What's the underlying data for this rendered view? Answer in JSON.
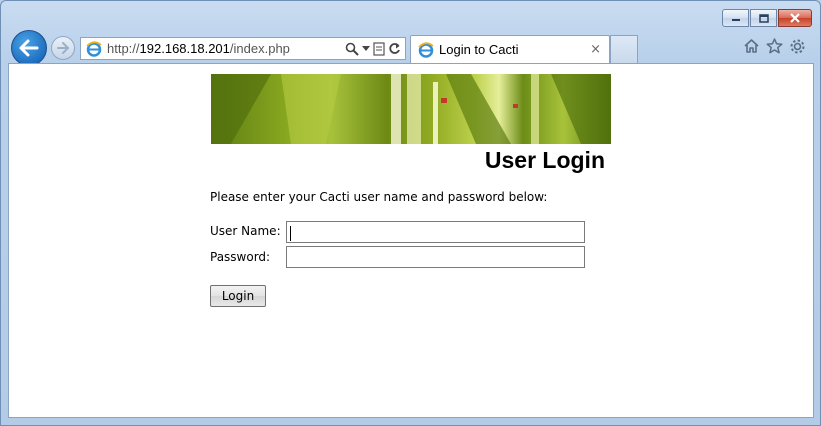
{
  "browser": {
    "url_prefix": "http://",
    "url_host": "192.168.18.201",
    "url_path": "/index.php",
    "tab_title": "Login to Cacti",
    "tab_close": "×",
    "icons": [
      "back-arrow-icon",
      "forward-arrow-icon",
      "ie-icon",
      "search-icon",
      "dropdown-icon",
      "compatibility-icon",
      "refresh-icon",
      "home-icon",
      "favorites-star-icon",
      "tools-gear-icon",
      "minimize-icon",
      "maximize-icon",
      "close-icon"
    ]
  },
  "page": {
    "title": "User Login",
    "intro": "Please enter your Cacti user name and password below:",
    "username_label": "User Name:",
    "username_value": "",
    "password_label": "Password:",
    "password_value": "",
    "login_button": "Login"
  }
}
